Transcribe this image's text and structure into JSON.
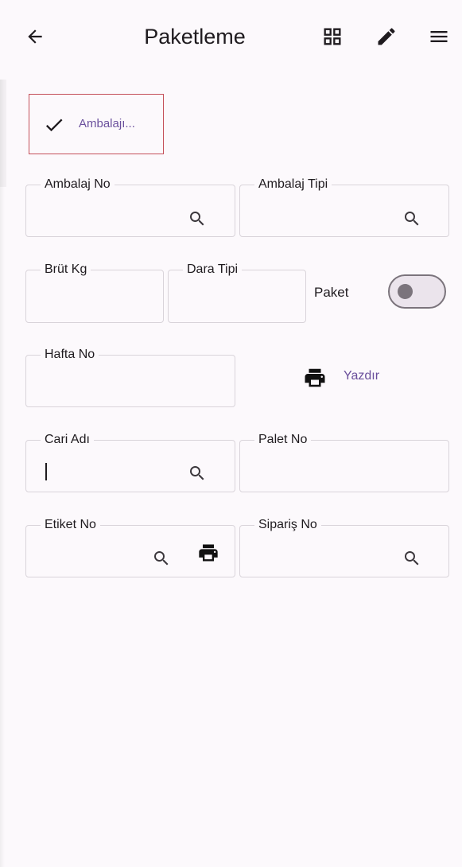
{
  "appbar": {
    "title": "Paketleme",
    "icons": [
      "arrow-back-icon",
      "grid-view-icon",
      "edit-icon",
      "menu-icon"
    ]
  },
  "chip": {
    "label": "Ambalajı...",
    "checked": true
  },
  "fields": {
    "ambalaj_no": {
      "label": "Ambalaj No",
      "value": ""
    },
    "ambalaj_tipi": {
      "label": "Ambalaj Tipi",
      "value": ""
    },
    "brut_kg": {
      "label": "Brüt Kg",
      "value": ""
    },
    "dara_tipi": {
      "label": "Dara Tipi",
      "value": ""
    },
    "hafta_no": {
      "label": "Hafta No",
      "value": ""
    },
    "cari_adi": {
      "label": "Cari Adı",
      "value": ""
    },
    "palet_no": {
      "label": "Palet No",
      "value": ""
    },
    "etiket_no": {
      "label": "Etiket No",
      "value": ""
    },
    "siparis_no": {
      "label": "Sipariş No",
      "value": ""
    }
  },
  "paket": {
    "label": "Paket",
    "on": false
  },
  "print_link": {
    "label": "Yazdır"
  },
  "colors": {
    "accent": "#6a4f9c",
    "chip_border": "#c4505a",
    "field_border": "#d9d4da",
    "background": "#fcf9fc"
  }
}
